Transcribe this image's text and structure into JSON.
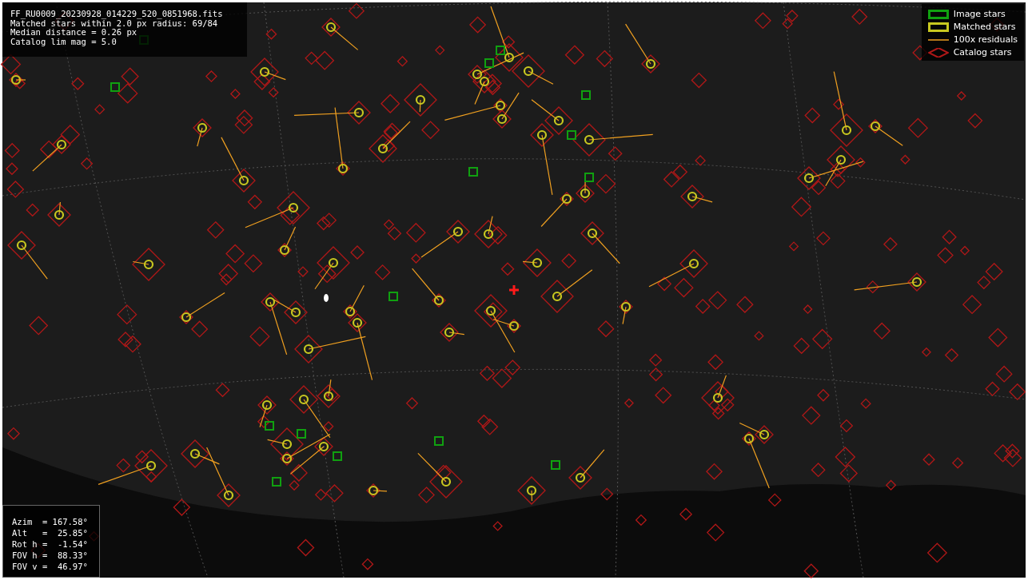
{
  "info_box": {
    "lines": [
      "FF_RU0009_20230928_014229_520_0851968.fits",
      "Matched stars within 2.0 px radius: 69/84",
      "Median distance = 0.26 px",
      "Catalog lim mag = 5.0"
    ]
  },
  "legend": {
    "items": [
      {
        "kind": "image",
        "label": "Image stars"
      },
      {
        "kind": "matched",
        "label": "Matched stars"
      },
      {
        "kind": "residual",
        "label": "100x residuals"
      },
      {
        "kind": "catalog",
        "label": "Catalog stars"
      }
    ]
  },
  "pointing_box": {
    "lines": [
      "Azim  = 167.58°",
      "Alt   =  25.85°",
      "Rot h =  -1.54°",
      "FOV h =  88.33°",
      "FOV v =  46.97°"
    ]
  }
}
